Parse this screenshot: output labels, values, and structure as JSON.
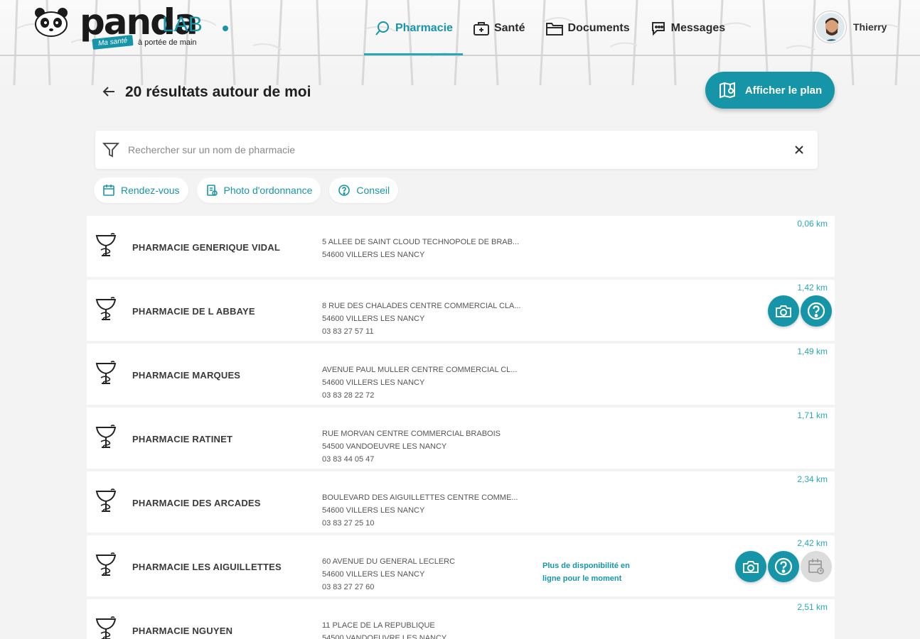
{
  "brand": {
    "name": "panda",
    "suffix": "LAB",
    "tagline_tag": "Ma santé",
    "tagline": "à portée de main"
  },
  "nav": {
    "items": [
      {
        "label": "Pharmacie",
        "icon": "search-icon",
        "active": true
      },
      {
        "label": "Santé",
        "icon": "first-aid-kit-icon",
        "active": false
      },
      {
        "label": "Documents",
        "icon": "folder-icon",
        "active": false
      },
      {
        "label": "Messages",
        "icon": "chat-icon",
        "active": false
      }
    ]
  },
  "user": {
    "name": "Thierry"
  },
  "page": {
    "title": "20 résultats autour de moi",
    "map_button": "Afficher le plan"
  },
  "search": {
    "placeholder": "Rechercher sur un nom de pharmacie",
    "value": ""
  },
  "filters": [
    {
      "label": "Rendez-vous",
      "icon": "calendar-icon"
    },
    {
      "label": "Photo d'ordonnance",
      "icon": "prescription-photo-icon"
    },
    {
      "label": "Conseil",
      "icon": "question-icon"
    }
  ],
  "colors": {
    "accent": "#1795a8",
    "distance": "#2aa7b6",
    "disabled": "#dcdcdc"
  },
  "pharmacies": [
    {
      "name": "PHARMACIE GENERIQUE VIDAL",
      "address": "5 ALLEE DE SAINT CLOUD TECHNOPOLE DE BRAB...",
      "city": "54600 VILLERS LES NANCY",
      "phone": "",
      "distance": "0,06 km",
      "note": "",
      "actions": []
    },
    {
      "name": "PHARMACIE DE L ABBAYE",
      "address": "8 RUE DES CHALADES CENTRE COMMERCIAL CLA...",
      "city": "54600 VILLERS LES NANCY",
      "phone": "03 83 27 57 11",
      "distance": "1,42 km",
      "note": "",
      "actions": [
        "camera-icon",
        "question-icon"
      ]
    },
    {
      "name": "PHARMACIE MARQUES",
      "address": "AVENUE PAUL MULLER CENTRE COMMERCIAL CL...",
      "city": "54600 VILLERS LES NANCY",
      "phone": "03 83 28 22 72",
      "distance": "1,49 km",
      "note": "",
      "actions": []
    },
    {
      "name": "PHARMACIE RATINET",
      "address": "RUE MORVAN CENTRE COMMERCIAL BRABOIS",
      "city": "54500 VANDOEUVRE LES NANCY",
      "phone": "03 83 44 05 47",
      "distance": "1,71 km",
      "note": "",
      "actions": []
    },
    {
      "name": "PHARMACIE DES ARCADES",
      "address": "BOULEVARD DES AIGUILLETTES CENTRE COMME...",
      "city": "54600 VILLERS LES NANCY",
      "phone": "03 83 27 25 10",
      "distance": "2,34 km",
      "note": "",
      "actions": []
    },
    {
      "name": "PHARMACIE LES AIGUILLETTES",
      "address": "60 AVENUE DU GENERAL LECLERC",
      "city": "54600 VILLERS LES NANCY",
      "phone": "03 83 27 27 60",
      "distance": "2,42 km",
      "note": "Plus de disponibilité en ligne pour le moment",
      "actions": [
        "camera-icon",
        "question-icon",
        "calendar-icon-disabled"
      ]
    },
    {
      "name": "PHARMACIE NGUYEN",
      "address": "11 PLACE DE LA REPUBLIQUE",
      "city": "54500 VANDOEUVRE LES NANCY",
      "phone": "",
      "distance": "2,51 km",
      "note": "",
      "actions": []
    }
  ]
}
